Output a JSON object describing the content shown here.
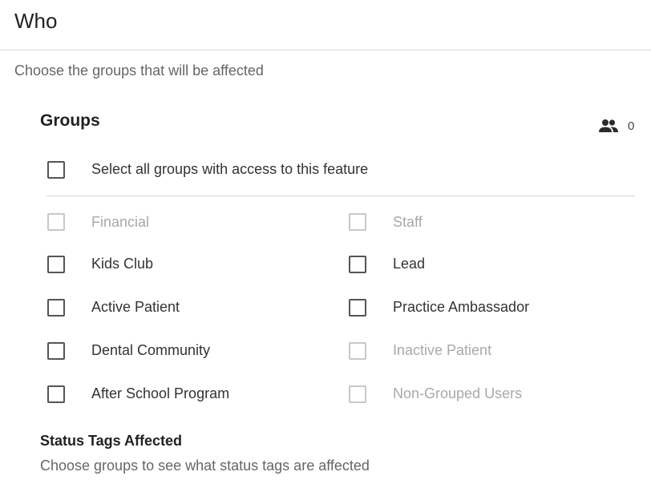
{
  "section": {
    "title": "Who",
    "subtitle": "Choose the groups that will be affected"
  },
  "groups": {
    "heading": "Groups",
    "count_icon": "people-icon",
    "selected_count": "0",
    "select_all_label": "Select all groups with access to this feature",
    "items": [
      {
        "label": "Financial",
        "checked": false,
        "disabled": true
      },
      {
        "label": "Staff",
        "checked": false,
        "disabled": true
      },
      {
        "label": "Kids Club",
        "checked": false,
        "disabled": false
      },
      {
        "label": "Lead",
        "checked": false,
        "disabled": false
      },
      {
        "label": "Active Patient",
        "checked": false,
        "disabled": false
      },
      {
        "label": "Practice Ambassador",
        "checked": false,
        "disabled": false
      },
      {
        "label": "Dental Community",
        "checked": false,
        "disabled": false
      },
      {
        "label": "Inactive Patient",
        "checked": false,
        "disabled": true
      },
      {
        "label": "After School Program",
        "checked": false,
        "disabled": false
      },
      {
        "label": "Non-Grouped Users",
        "checked": false,
        "disabled": true
      }
    ]
  },
  "status_tags": {
    "heading": "Status Tags Affected",
    "helper_text": "Choose groups to see what status tags are affected"
  },
  "colors": {
    "checkbox_border": "#555555",
    "checkbox_disabled_border": "#c8c8c8",
    "label_text": "#333333",
    "disabled_text": "#a9a9a9",
    "muted_text": "#666666",
    "divider": "#d6d6d6"
  }
}
